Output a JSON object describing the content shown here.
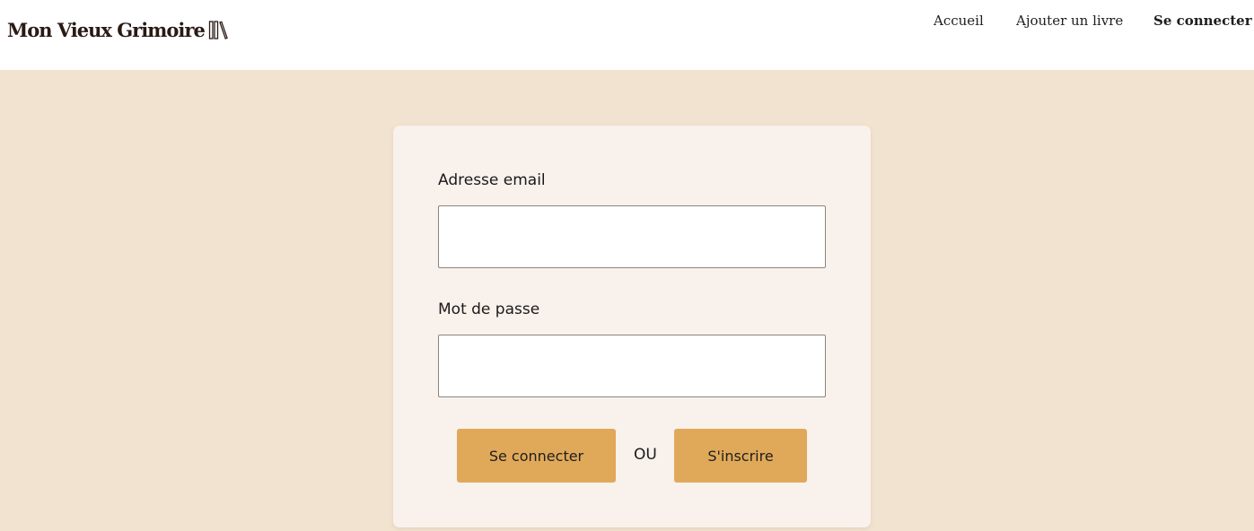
{
  "header": {
    "logo_text": "Mon Vieux Grimoire",
    "logo_icon": "books-icon",
    "nav": {
      "home_label": "Accueil",
      "add_book_label": "Ajouter un livre",
      "login_label": "Se connecter"
    }
  },
  "login_form": {
    "email_label": "Adresse email",
    "email_value": "",
    "password_label": "Mot de passe",
    "password_value": "",
    "login_button_label": "Se connecter",
    "or_text": "OU",
    "signup_button_label": "S'inscrire"
  },
  "colors": {
    "page_background": "#F2E3D0",
    "header_background": "#FFFFFF",
    "card_background": "#F9F1EC",
    "button_background": "#E0A95A",
    "logo_text": "#2A1A14"
  }
}
